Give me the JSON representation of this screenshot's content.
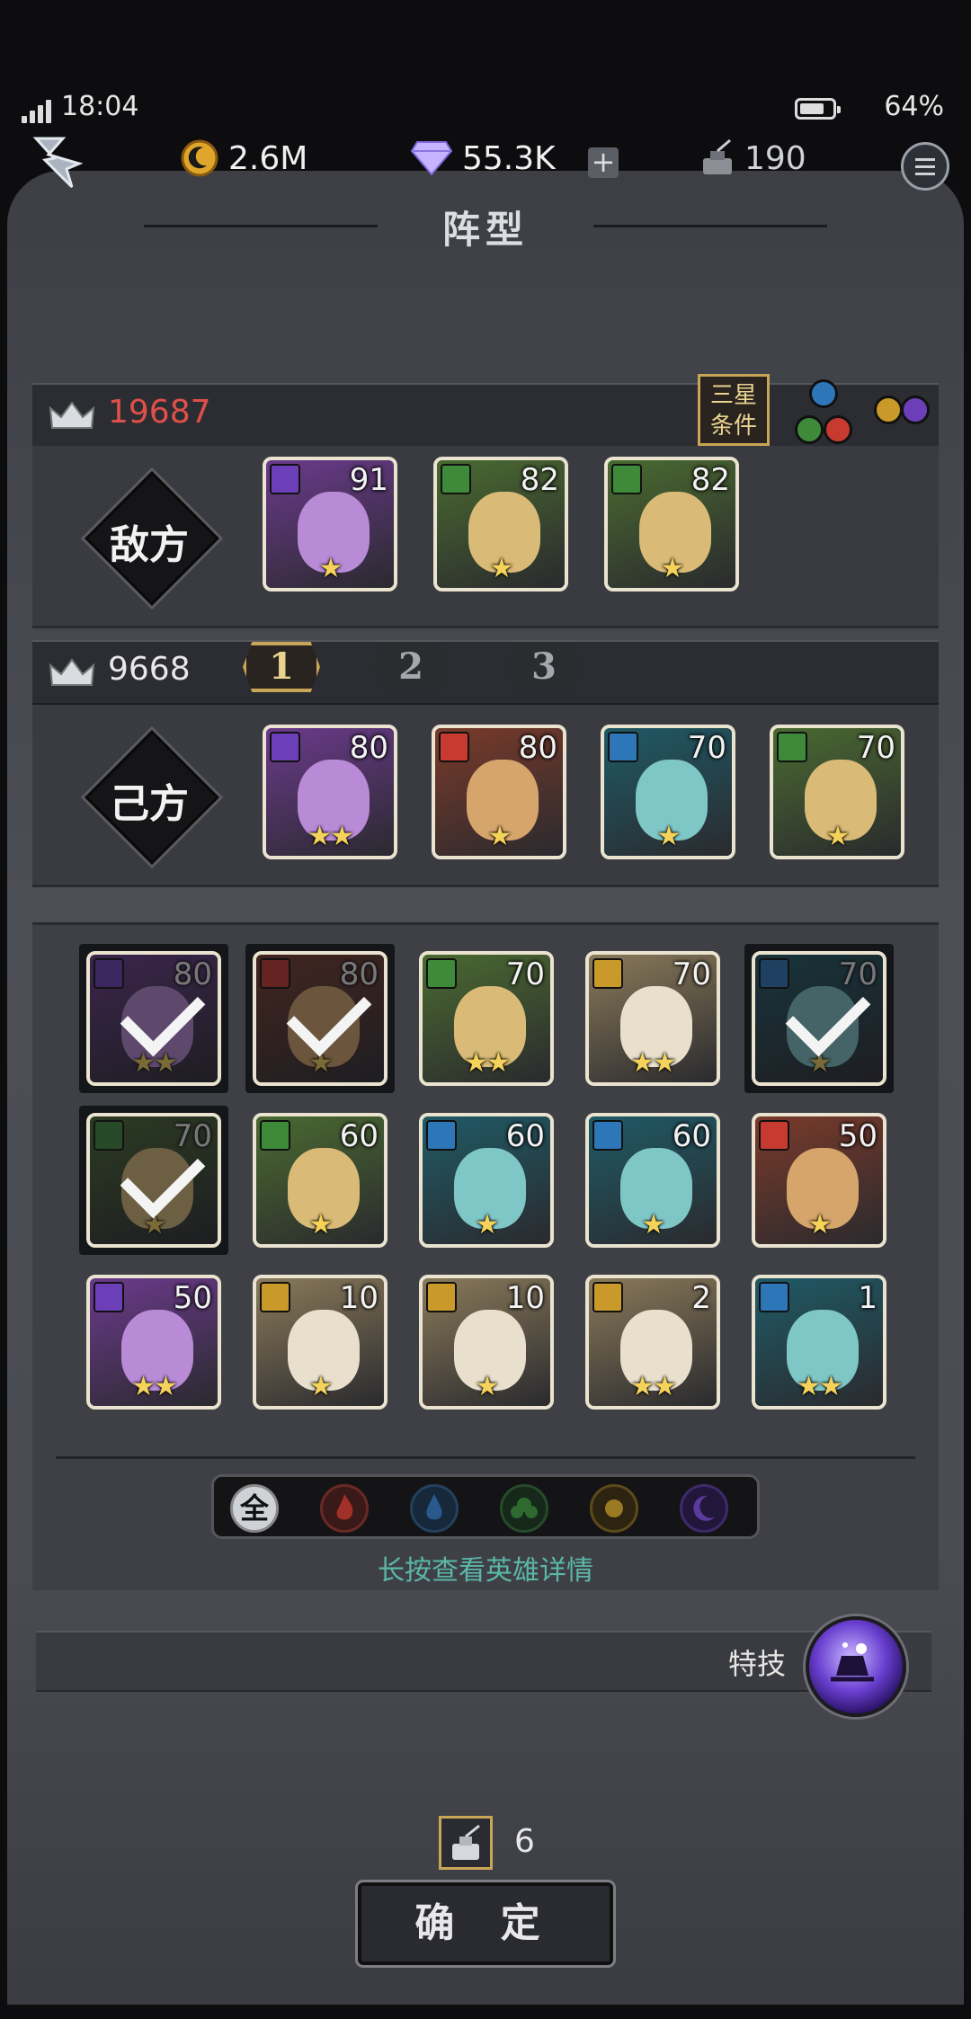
{
  "status": {
    "time": "18:04",
    "battery": "64%"
  },
  "currency": {
    "gold": "2.6M",
    "gems": "55.3K",
    "ink": "190"
  },
  "title": "阵型",
  "enemy": {
    "power": "19687",
    "label": "敌方",
    "three_star_label": "三星\n条件",
    "heroes": [
      {
        "level": "91",
        "stars": "★",
        "element": "moon"
      },
      {
        "level": "82",
        "stars": "★",
        "element": "leaf"
      },
      {
        "level": "82",
        "stars": "★",
        "element": "leaf"
      }
    ]
  },
  "ally": {
    "power": "9668",
    "label": "己方",
    "tabs": [
      "1",
      "2",
      "3"
    ],
    "heroes": [
      {
        "level": "80",
        "stars": "★★",
        "element": "moon"
      },
      {
        "level": "80",
        "stars": "★",
        "element": "fire"
      },
      {
        "level": "70",
        "stars": "★",
        "element": "water"
      },
      {
        "level": "70",
        "stars": "★",
        "element": "leaf"
      }
    ]
  },
  "roster": [
    {
      "level": "80",
      "stars": "★★",
      "element": "moon",
      "selected": true
    },
    {
      "level": "80",
      "stars": "★",
      "element": "fire",
      "selected": true
    },
    {
      "level": "70",
      "stars": "★★",
      "element": "leaf",
      "selected": false
    },
    {
      "level": "70",
      "stars": "★★",
      "element": "sun",
      "selected": false
    },
    {
      "level": "70",
      "stars": "★",
      "element": "water",
      "selected": true
    },
    {
      "level": "70",
      "stars": "★",
      "element": "leaf",
      "selected": true
    },
    {
      "level": "60",
      "stars": "★",
      "element": "leaf",
      "selected": false
    },
    {
      "level": "60",
      "stars": "★",
      "element": "water",
      "selected": false
    },
    {
      "level": "60",
      "stars": "★",
      "element": "water",
      "selected": false
    },
    {
      "level": "50",
      "stars": "★",
      "element": "fire",
      "selected": false
    },
    {
      "level": "50",
      "stars": "★★",
      "element": "moon",
      "selected": false
    },
    {
      "level": "10",
      "stars": "★",
      "element": "sun",
      "selected": false
    },
    {
      "level": "10",
      "stars": "★",
      "element": "sun",
      "selected": false
    },
    {
      "level": "2",
      "stars": "★★",
      "element": "sun",
      "selected": false
    },
    {
      "level": "1",
      "stars": "★★",
      "element": "water",
      "selected": false
    }
  ],
  "filter": {
    "all_label": "全"
  },
  "hint": "长按查看英雄详情",
  "skill_label": "特技",
  "ink_cost": "6",
  "confirm_label": "确 定",
  "colors": {
    "fire": "#c63a30",
    "water": "#2d76b8",
    "leaf": "#3e8a3a",
    "sun": "#c99a2a",
    "moon": "#6c3fb8",
    "power_enemy": "#e0504a"
  }
}
